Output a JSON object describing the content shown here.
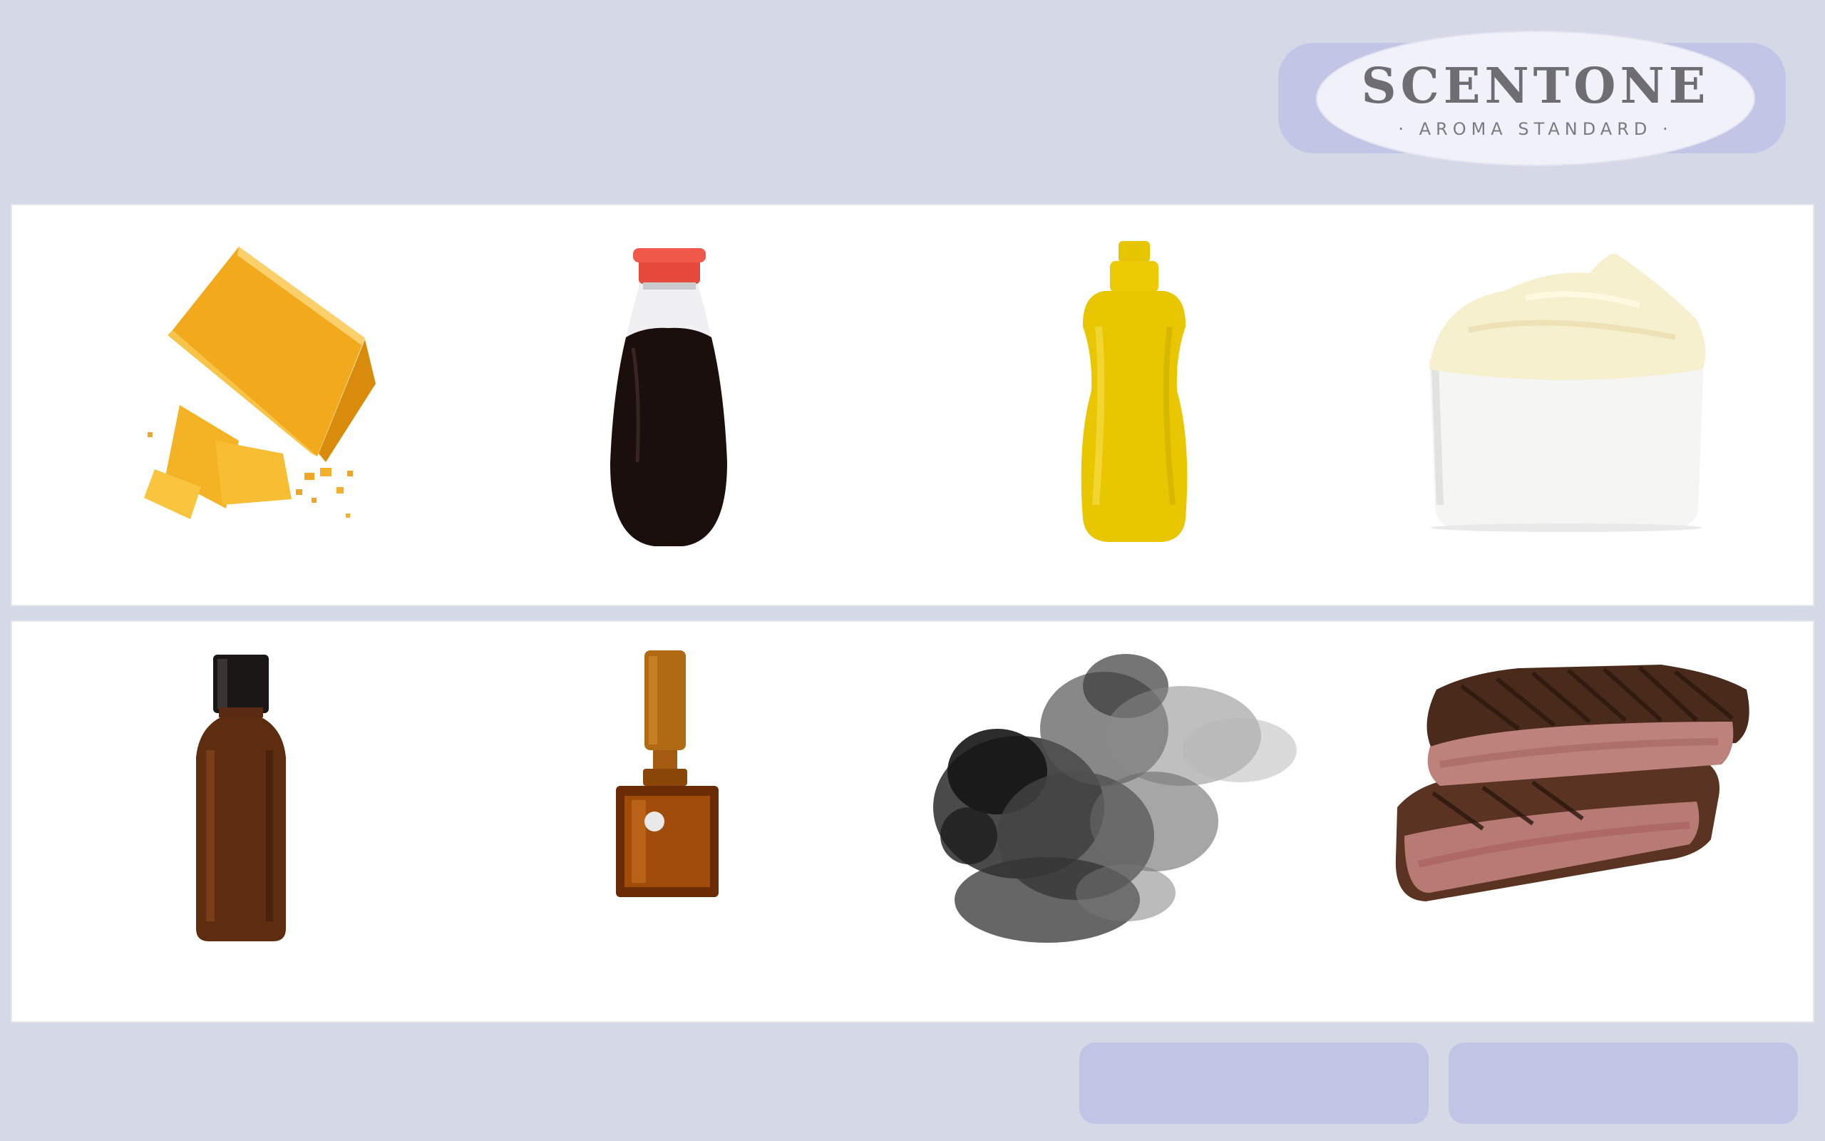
{
  "logo": {
    "title": "SCENTONE",
    "subtitle": "· AROMA STANDARD ·"
  },
  "colors": {
    "background": "#d5d8e5",
    "panel": "#ffffff",
    "accent": "#c2c4e6"
  },
  "aroma_grid": {
    "row_1": [
      "cheese-icon",
      "soy-sauce-bottle-icon",
      "mustard-bottle-icon",
      "mayonnaise-bowl-icon"
    ],
    "row_2": [
      "amber-spray-bottle-icon",
      "amber-perfume-bottle-icon",
      "smoke-icon",
      "grilled-steak-icon"
    ]
  },
  "buttons": [
    {
      "name": "left-action-button",
      "label": ""
    },
    {
      "name": "right-action-button",
      "label": ""
    }
  ]
}
